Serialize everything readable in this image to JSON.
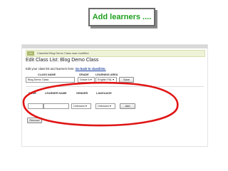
{
  "slide": {
    "title": "Add learners ...."
  },
  "notice": {
    "badge": "Info",
    "text": "Class/list Blog Demo Class was modified"
  },
  "page": {
    "title": "Edit Class List: Blog Demo Class"
  },
  "instructions": {
    "text": "Edit your class list and learners here. ",
    "back_link": "Go back to classlists."
  },
  "class_table": {
    "headers": [
      "CLASS NAME",
      "GRADE",
      "LEARNING AREA"
    ],
    "class_name": "Blog Demo Class",
    "grade": "Grade 6 ▾",
    "learning_area": "English FAL ▾",
    "save_label": "Save"
  },
  "learner_table": {
    "headers": [
      "CODE",
      "LEARNER NAME",
      "GENDER",
      "LANGUAGE"
    ],
    "code_value": "",
    "name_value": "",
    "gender": "Unknown ▾",
    "language": "Unknown ▾",
    "add_label": "Add"
  },
  "remove_label": "Remove",
  "colors": {
    "title_green": "#1fa01f",
    "highlight_red": "#e01515",
    "link_blue": "#1b3f9c"
  }
}
